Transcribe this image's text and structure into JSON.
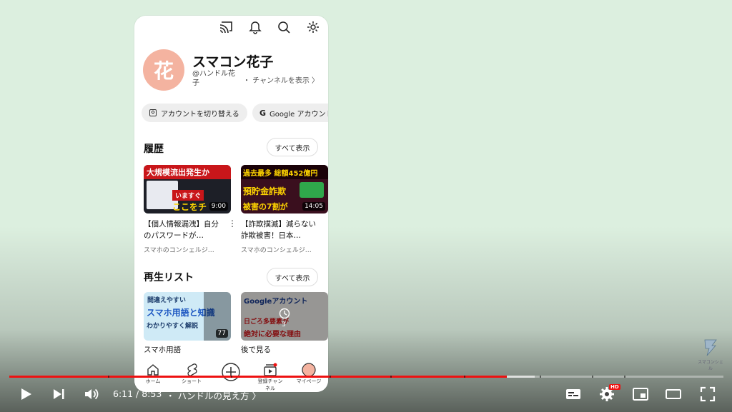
{
  "profile": {
    "avatar_char": "花",
    "name": "スマコン花子",
    "handle": "@ハンドル花子",
    "channel_link": "・ チャンネルを表示 〉"
  },
  "account_pills": [
    {
      "label": "アカウントを切り替える",
      "icon": "switch-account-icon"
    },
    {
      "label": "Google アカウント",
      "icon": "google-g-icon"
    }
  ],
  "history": {
    "title": "履歴",
    "show_all": "すべて表示",
    "videos": [
      {
        "thumb_line1": "大規模流出発生か",
        "thumb_line2": "いますぐ",
        "thumb_line3": "ここをチ",
        "duration": "9:00",
        "title": "【個人情報漏洩】自分のパスワードが…",
        "channel": "スマホのコンシェルジ…"
      },
      {
        "thumb_line1": "過去最多 総額452億円",
        "thumb_line2": "預貯金詐欺",
        "thumb_line3": "被害の7割が",
        "duration": "14:05",
        "title": "【詐欺撲滅】減らない詐欺被害！日本…",
        "channel": "スマホのコンシェルジ…"
      }
    ]
  },
  "playlists": {
    "title": "再生リスト",
    "show_all": "すべて表示",
    "items": [
      {
        "thumb_line1": "間違えやすい",
        "thumb_line2": "スマホ用語と知識",
        "thumb_line3": "わかりやすく解説",
        "count": "77",
        "title": "スマホ用語"
      },
      {
        "thumb_line1": "Googleアカウント",
        "thumb_line2": "日ごろ多要素が",
        "thumb_line3": "絶対に必要な理由",
        "count": "3",
        "title": "後で見る"
      }
    ]
  },
  "bottom_nav": [
    {
      "label": "ホーム",
      "icon": "home-icon"
    },
    {
      "label": "ショート",
      "icon": "shorts-icon"
    },
    {
      "label": "",
      "icon": "create-plus-icon"
    },
    {
      "label": "登録チャンネル",
      "icon": "subscriptions-icon"
    },
    {
      "label": "マイページ",
      "icon": "avatar-icon"
    }
  ],
  "player": {
    "time": "6:11 / 8:53",
    "chapter": "・ ハンドルの見え方 〉",
    "progress": 0.697,
    "buffered": 0.736,
    "hd_badge": "HD",
    "accent": "#ee1111"
  },
  "watermark": "スマコンシェル"
}
